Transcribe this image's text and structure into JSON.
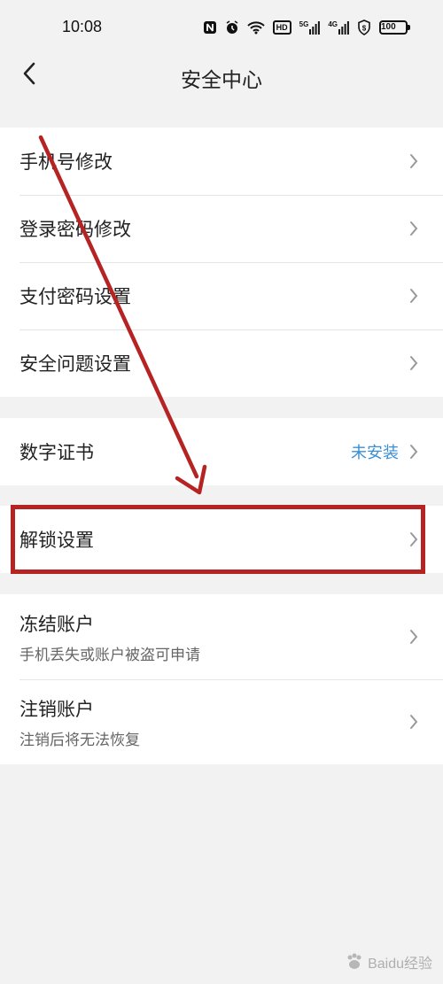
{
  "status_bar": {
    "time": "10:08",
    "hd_label": "HD",
    "net1_label": "5G",
    "net2_label": "4G",
    "battery": "100"
  },
  "nav": {
    "title": "安全中心"
  },
  "groups": [
    {
      "items": [
        {
          "label": "手机号修改"
        },
        {
          "label": "登录密码修改"
        },
        {
          "label": "支付密码设置"
        },
        {
          "label": "安全问题设置"
        }
      ]
    },
    {
      "items": [
        {
          "label": "数字证书",
          "value": "未安装"
        }
      ]
    },
    {
      "items": [
        {
          "label": "解锁设置"
        }
      ]
    },
    {
      "items": [
        {
          "label": "冻结账户",
          "sub": "手机丢失或账户被盗可申请"
        },
        {
          "label": "注销账户",
          "sub": "注销后将无法恢复"
        }
      ]
    }
  ],
  "colors": {
    "page_bg": "#f2f2f3",
    "accent_value": "#3a8fd6",
    "annotation_red": "#b52323"
  },
  "watermark": {
    "text": "Baidu经验"
  }
}
